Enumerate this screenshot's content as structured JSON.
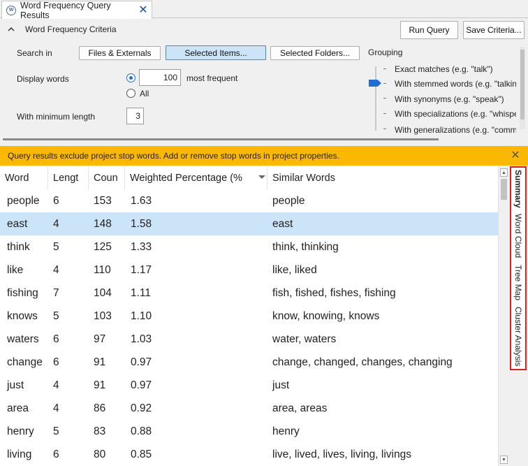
{
  "tab": {
    "title": "Word Frequency Query Results",
    "icon_text": "W"
  },
  "criteria": {
    "title": "Word Frequency Criteria",
    "run_query": "Run Query",
    "save_criteria": "Save Criteria...",
    "search_in_label": "Search in",
    "search_buttons": [
      "Files & Externals",
      "Selected Items...",
      "Selected Folders..."
    ],
    "selected_search": "Selected Items...",
    "display_words_label": "Display words",
    "display_count": "100",
    "most_frequent": "most frequent",
    "all_label": "All",
    "min_length_label": "With minimum length",
    "min_length": "3",
    "grouping_label": "Grouping",
    "grouping_options": [
      "Exact matches (e.g. \"talk\")",
      "With stemmed words (e.g. \"talking\")",
      "With synonyms (e.g. \"speak\")",
      "With specializations (e.g. \"whisper\")",
      "With generalizations (e.g. \"communicate\")"
    ]
  },
  "banner": {
    "text": "Query results exclude project stop words. Add or remove stop words in project properties."
  },
  "grid": {
    "columns": [
      "Word",
      "Lengt",
      "Coun",
      "Weighted Percentage (%",
      "Similar Words"
    ],
    "rows": [
      [
        "people",
        "6",
        "153",
        "1.63",
        "people"
      ],
      [
        "east",
        "4",
        "148",
        "1.58",
        "east"
      ],
      [
        "think",
        "5",
        "125",
        "1.33",
        "think, thinking"
      ],
      [
        "like",
        "4",
        "110",
        "1.17",
        "like, liked"
      ],
      [
        "fishing",
        "7",
        "104",
        "1.11",
        "fish, fished, fishes, fishing"
      ],
      [
        "knows",
        "5",
        "103",
        "1.10",
        "know, knowing, knows"
      ],
      [
        "waters",
        "6",
        "97",
        "1.03",
        "water, waters"
      ],
      [
        "change",
        "6",
        "91",
        "0.97",
        "change, changed, changes, changing"
      ],
      [
        "just",
        "4",
        "91",
        "0.97",
        "just"
      ],
      [
        "area",
        "4",
        "86",
        "0.92",
        "area, areas"
      ],
      [
        "henry",
        "5",
        "83",
        "0.88",
        "henry"
      ],
      [
        "living",
        "6",
        "80",
        "0.85",
        "live, lived, lives, living, livings"
      ]
    ],
    "selected_row": 1
  },
  "side_tabs": [
    "Summary",
    "Word Cloud",
    "Tree Map",
    "Cluster Analysis"
  ],
  "colors": {
    "banner": "#fbb800",
    "selection": "#cce4f7",
    "accent": "#1f6fd0",
    "highlight_border": "#d62020"
  }
}
